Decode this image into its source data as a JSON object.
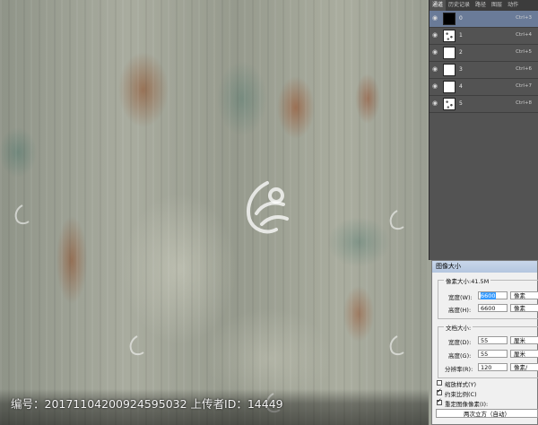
{
  "footer": {
    "caption": "编号：20171104200924595032 上传者ID：14449"
  },
  "layers_panel": {
    "tabs": [
      "通道",
      "历史记录",
      "路径",
      "图层",
      "动作"
    ],
    "layers": [
      {
        "name": "0",
        "shortcut": "Ctrl+3",
        "thumb": "black"
      },
      {
        "name": "1",
        "shortcut": "Ctrl+4",
        "thumb": "spots"
      },
      {
        "name": "2",
        "shortcut": "Ctrl+5",
        "thumb": "white"
      },
      {
        "name": "3",
        "shortcut": "Ctrl+6",
        "thumb": "white"
      },
      {
        "name": "4",
        "shortcut": "Ctrl+7",
        "thumb": "white"
      },
      {
        "name": "5",
        "shortcut": "Ctrl+8",
        "thumb": "spots"
      }
    ],
    "selected_color": "#6a7b98"
  },
  "dialog": {
    "title": "图像大小",
    "pixel_dimensions_label": "像素大小:41.5M",
    "width_label": "宽度(W):",
    "width_value": "6600",
    "width_unit": "像素",
    "height_label": "高度(H):",
    "height_value": "6600",
    "height_unit": "像素",
    "document_size_label": "文档大小:",
    "doc_width_label": "宽度(D):",
    "doc_width_value": "55",
    "doc_width_unit": "厘米",
    "doc_height_label": "高度(G):",
    "doc_height_value": "55",
    "doc_height_unit": "厘米",
    "resolution_label": "分辨率(R):",
    "resolution_value": "120",
    "resolution_unit": "像素/",
    "scale_styles_label": "缩放样式(Y)",
    "constrain_label": "约束比例(C)",
    "resample_label": "重定图像像素(I):",
    "resample_method": "两次立方（自动）"
  }
}
